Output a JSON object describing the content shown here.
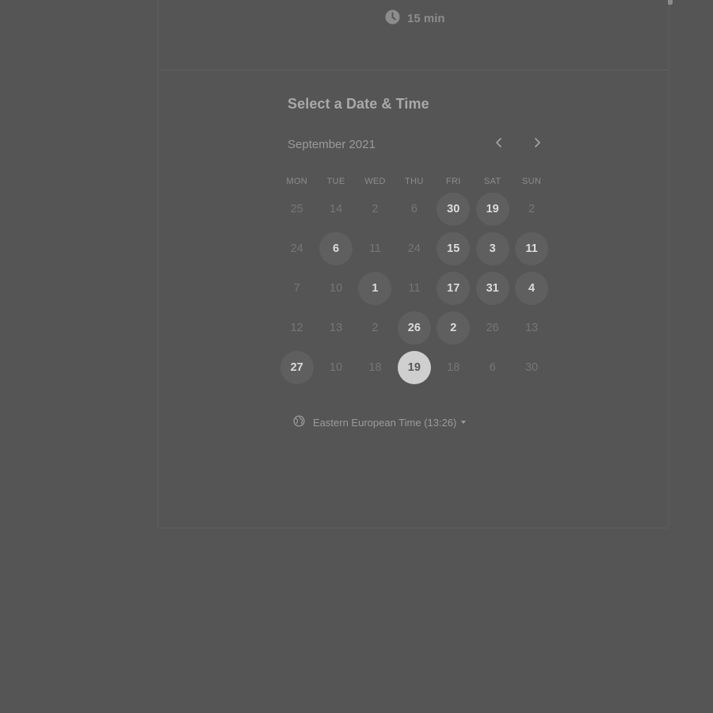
{
  "header": {
    "duration": "15 min",
    "duration_icon": "clock-icon"
  },
  "picker": {
    "title": "Select a Date & Time",
    "month": "September 2021",
    "prev_icon": "chevron-left-icon",
    "next_icon": "chevron-right-icon",
    "weekdays": [
      "MON",
      "TUE",
      "WED",
      "THU",
      "FRI",
      "SAT",
      "SUN"
    ],
    "weeks": [
      [
        {
          "d": "25",
          "s": "unavailable"
        },
        {
          "d": "14",
          "s": "unavailable"
        },
        {
          "d": "2",
          "s": "unavailable"
        },
        {
          "d": "6",
          "s": "unavailable"
        },
        {
          "d": "30",
          "s": "available"
        },
        {
          "d": "19",
          "s": "available"
        },
        {
          "d": "2",
          "s": "unavailable"
        }
      ],
      [
        {
          "d": "24",
          "s": "unavailable"
        },
        {
          "d": "6",
          "s": "available"
        },
        {
          "d": "11",
          "s": "unavailable"
        },
        {
          "d": "24",
          "s": "unavailable"
        },
        {
          "d": "15",
          "s": "available"
        },
        {
          "d": "3",
          "s": "available"
        },
        {
          "d": "11",
          "s": "available"
        }
      ],
      [
        {
          "d": "7",
          "s": "unavailable"
        },
        {
          "d": "10",
          "s": "unavailable"
        },
        {
          "d": "1",
          "s": "available"
        },
        {
          "d": "11",
          "s": "unavailable"
        },
        {
          "d": "17",
          "s": "available"
        },
        {
          "d": "31",
          "s": "available"
        },
        {
          "d": "4",
          "s": "available"
        }
      ],
      [
        {
          "d": "12",
          "s": "unavailable"
        },
        {
          "d": "13",
          "s": "unavailable"
        },
        {
          "d": "2",
          "s": "unavailable"
        },
        {
          "d": "26",
          "s": "available"
        },
        {
          "d": "2",
          "s": "available"
        },
        {
          "d": "26",
          "s": "unavailable"
        },
        {
          "d": "13",
          "s": "unavailable"
        }
      ],
      [
        {
          "d": "27",
          "s": "available"
        },
        {
          "d": "10",
          "s": "unavailable"
        },
        {
          "d": "18",
          "s": "unavailable"
        },
        {
          "d": "19",
          "s": "selected"
        },
        {
          "d": "18",
          "s": "unavailable"
        },
        {
          "d": "6",
          "s": "unavailable"
        },
        {
          "d": "30",
          "s": "unavailable"
        }
      ]
    ],
    "timezone": "Eastern European Time (13:26)",
    "timezone_icon": "globe-icon"
  },
  "colors": {
    "background": "#555555",
    "available_day": "#5f5f5f",
    "selected_day": "#cfcfcf"
  }
}
